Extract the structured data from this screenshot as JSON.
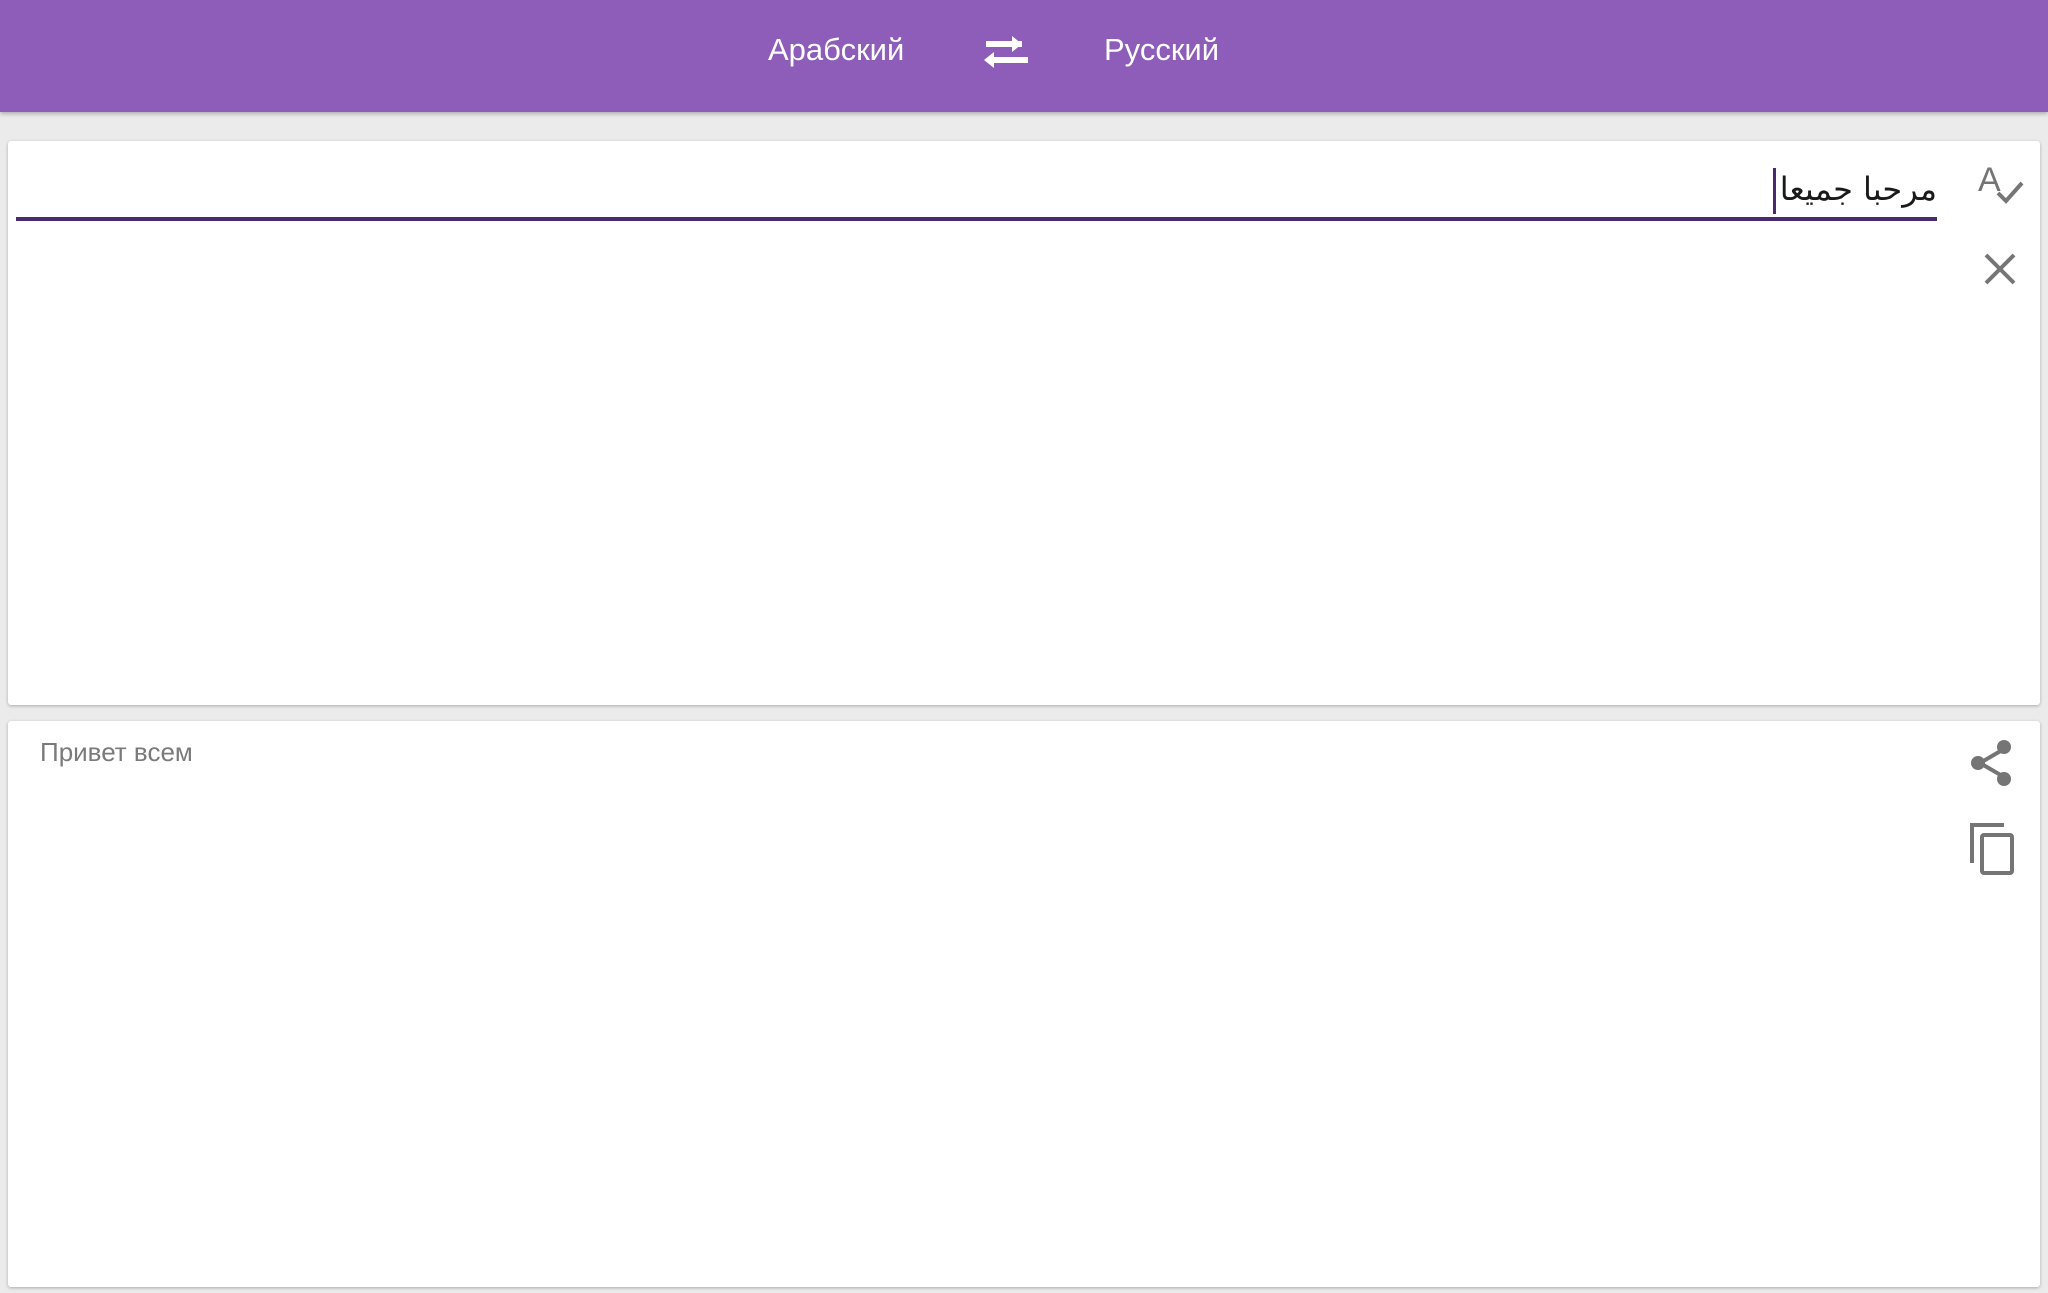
{
  "header": {
    "source_language": "Арабский",
    "target_language": "Русский",
    "swap_icon": "swap-arrows-icon"
  },
  "input": {
    "text": "مرحبا جميعا",
    "spellcheck_icon": "spellcheck-icon",
    "clear_icon": "close-icon"
  },
  "output": {
    "text": "Привет всем",
    "share_icon": "share-icon",
    "copy_icon": "copy-icon"
  },
  "colors": {
    "header": "#8e5cb9",
    "underline": "#4a2a6e",
    "icon": "#757575"
  }
}
